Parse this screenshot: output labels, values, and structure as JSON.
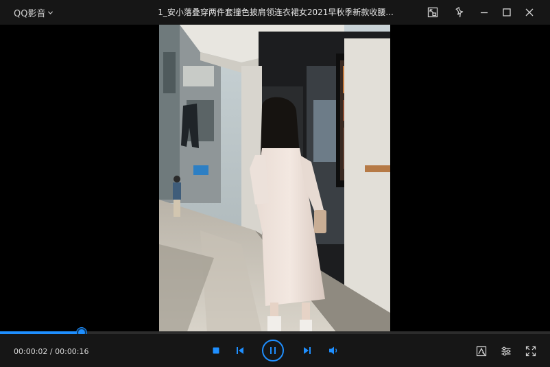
{
  "app": {
    "name": "QQ影音"
  },
  "video": {
    "title": "1_安小落叠穿两件套撞色披肩领连衣裙女2021早秋季新款收腰..."
  },
  "playback": {
    "current_time": "00:00:02",
    "separator": " / ",
    "total_time": "00:00:16",
    "progress_fraction": 0.148
  },
  "colors": {
    "accent": "#1f8fff",
    "bar_bg": "#161616",
    "icon_light": "#d8d8d8"
  },
  "icons": {
    "app_menu": "chevron-down-icon",
    "mini_mode": "mini-mode-icon",
    "pin": "pin-icon",
    "minimize": "minimize-icon",
    "maximize": "maximize-icon",
    "close": "close-icon",
    "stop": "stop-icon",
    "prev": "skip-previous-icon",
    "play_pause": "pause-icon",
    "next": "skip-next-icon",
    "volume": "volume-icon",
    "screenshot": "screenshot-icon",
    "settings": "settings-sliders-icon",
    "fullscreen": "fullscreen-icon"
  }
}
